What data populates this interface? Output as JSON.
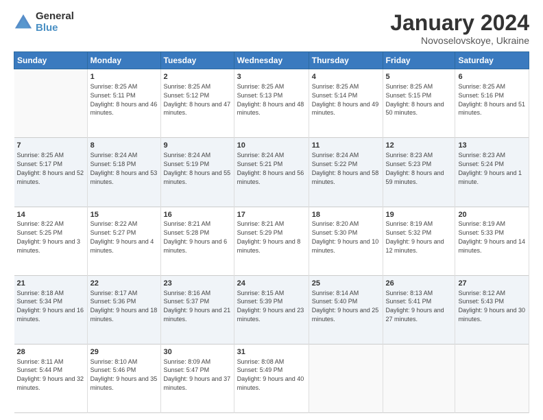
{
  "logo": {
    "general": "General",
    "blue": "Blue"
  },
  "header": {
    "month": "January 2024",
    "location": "Novoselovskoye, Ukraine"
  },
  "weekdays": [
    "Sunday",
    "Monday",
    "Tuesday",
    "Wednesday",
    "Thursday",
    "Friday",
    "Saturday"
  ],
  "weeks": [
    [
      {
        "day": "",
        "sunrise": "",
        "sunset": "",
        "daylight": ""
      },
      {
        "day": "1",
        "sunrise": "Sunrise: 8:25 AM",
        "sunset": "Sunset: 5:11 PM",
        "daylight": "Daylight: 8 hours and 46 minutes."
      },
      {
        "day": "2",
        "sunrise": "Sunrise: 8:25 AM",
        "sunset": "Sunset: 5:12 PM",
        "daylight": "Daylight: 8 hours and 47 minutes."
      },
      {
        "day": "3",
        "sunrise": "Sunrise: 8:25 AM",
        "sunset": "Sunset: 5:13 PM",
        "daylight": "Daylight: 8 hours and 48 minutes."
      },
      {
        "day": "4",
        "sunrise": "Sunrise: 8:25 AM",
        "sunset": "Sunset: 5:14 PM",
        "daylight": "Daylight: 8 hours and 49 minutes."
      },
      {
        "day": "5",
        "sunrise": "Sunrise: 8:25 AM",
        "sunset": "Sunset: 5:15 PM",
        "daylight": "Daylight: 8 hours and 50 minutes."
      },
      {
        "day": "6",
        "sunrise": "Sunrise: 8:25 AM",
        "sunset": "Sunset: 5:16 PM",
        "daylight": "Daylight: 8 hours and 51 minutes."
      }
    ],
    [
      {
        "day": "7",
        "sunrise": "Sunrise: 8:25 AM",
        "sunset": "Sunset: 5:17 PM",
        "daylight": "Daylight: 8 hours and 52 minutes."
      },
      {
        "day": "8",
        "sunrise": "Sunrise: 8:24 AM",
        "sunset": "Sunset: 5:18 PM",
        "daylight": "Daylight: 8 hours and 53 minutes."
      },
      {
        "day": "9",
        "sunrise": "Sunrise: 8:24 AM",
        "sunset": "Sunset: 5:19 PM",
        "daylight": "Daylight: 8 hours and 55 minutes."
      },
      {
        "day": "10",
        "sunrise": "Sunrise: 8:24 AM",
        "sunset": "Sunset: 5:21 PM",
        "daylight": "Daylight: 8 hours and 56 minutes."
      },
      {
        "day": "11",
        "sunrise": "Sunrise: 8:24 AM",
        "sunset": "Sunset: 5:22 PM",
        "daylight": "Daylight: 8 hours and 58 minutes."
      },
      {
        "day": "12",
        "sunrise": "Sunrise: 8:23 AM",
        "sunset": "Sunset: 5:23 PM",
        "daylight": "Daylight: 8 hours and 59 minutes."
      },
      {
        "day": "13",
        "sunrise": "Sunrise: 8:23 AM",
        "sunset": "Sunset: 5:24 PM",
        "daylight": "Daylight: 9 hours and 1 minute."
      }
    ],
    [
      {
        "day": "14",
        "sunrise": "Sunrise: 8:22 AM",
        "sunset": "Sunset: 5:25 PM",
        "daylight": "Daylight: 9 hours and 3 minutes."
      },
      {
        "day": "15",
        "sunrise": "Sunrise: 8:22 AM",
        "sunset": "Sunset: 5:27 PM",
        "daylight": "Daylight: 9 hours and 4 minutes."
      },
      {
        "day": "16",
        "sunrise": "Sunrise: 8:21 AM",
        "sunset": "Sunset: 5:28 PM",
        "daylight": "Daylight: 9 hours and 6 minutes."
      },
      {
        "day": "17",
        "sunrise": "Sunrise: 8:21 AM",
        "sunset": "Sunset: 5:29 PM",
        "daylight": "Daylight: 9 hours and 8 minutes."
      },
      {
        "day": "18",
        "sunrise": "Sunrise: 8:20 AM",
        "sunset": "Sunset: 5:30 PM",
        "daylight": "Daylight: 9 hours and 10 minutes."
      },
      {
        "day": "19",
        "sunrise": "Sunrise: 8:19 AM",
        "sunset": "Sunset: 5:32 PM",
        "daylight": "Daylight: 9 hours and 12 minutes."
      },
      {
        "day": "20",
        "sunrise": "Sunrise: 8:19 AM",
        "sunset": "Sunset: 5:33 PM",
        "daylight": "Daylight: 9 hours and 14 minutes."
      }
    ],
    [
      {
        "day": "21",
        "sunrise": "Sunrise: 8:18 AM",
        "sunset": "Sunset: 5:34 PM",
        "daylight": "Daylight: 9 hours and 16 minutes."
      },
      {
        "day": "22",
        "sunrise": "Sunrise: 8:17 AM",
        "sunset": "Sunset: 5:36 PM",
        "daylight": "Daylight: 9 hours and 18 minutes."
      },
      {
        "day": "23",
        "sunrise": "Sunrise: 8:16 AM",
        "sunset": "Sunset: 5:37 PM",
        "daylight": "Daylight: 9 hours and 21 minutes."
      },
      {
        "day": "24",
        "sunrise": "Sunrise: 8:15 AM",
        "sunset": "Sunset: 5:39 PM",
        "daylight": "Daylight: 9 hours and 23 minutes."
      },
      {
        "day": "25",
        "sunrise": "Sunrise: 8:14 AM",
        "sunset": "Sunset: 5:40 PM",
        "daylight": "Daylight: 9 hours and 25 minutes."
      },
      {
        "day": "26",
        "sunrise": "Sunrise: 8:13 AM",
        "sunset": "Sunset: 5:41 PM",
        "daylight": "Daylight: 9 hours and 27 minutes."
      },
      {
        "day": "27",
        "sunrise": "Sunrise: 8:12 AM",
        "sunset": "Sunset: 5:43 PM",
        "daylight": "Daylight: 9 hours and 30 minutes."
      }
    ],
    [
      {
        "day": "28",
        "sunrise": "Sunrise: 8:11 AM",
        "sunset": "Sunset: 5:44 PM",
        "daylight": "Daylight: 9 hours and 32 minutes."
      },
      {
        "day": "29",
        "sunrise": "Sunrise: 8:10 AM",
        "sunset": "Sunset: 5:46 PM",
        "daylight": "Daylight: 9 hours and 35 minutes."
      },
      {
        "day": "30",
        "sunrise": "Sunrise: 8:09 AM",
        "sunset": "Sunset: 5:47 PM",
        "daylight": "Daylight: 9 hours and 37 minutes."
      },
      {
        "day": "31",
        "sunrise": "Sunrise: 8:08 AM",
        "sunset": "Sunset: 5:49 PM",
        "daylight": "Daylight: 9 hours and 40 minutes."
      },
      {
        "day": "",
        "sunrise": "",
        "sunset": "",
        "daylight": ""
      },
      {
        "day": "",
        "sunrise": "",
        "sunset": "",
        "daylight": ""
      },
      {
        "day": "",
        "sunrise": "",
        "sunset": "",
        "daylight": ""
      }
    ]
  ]
}
